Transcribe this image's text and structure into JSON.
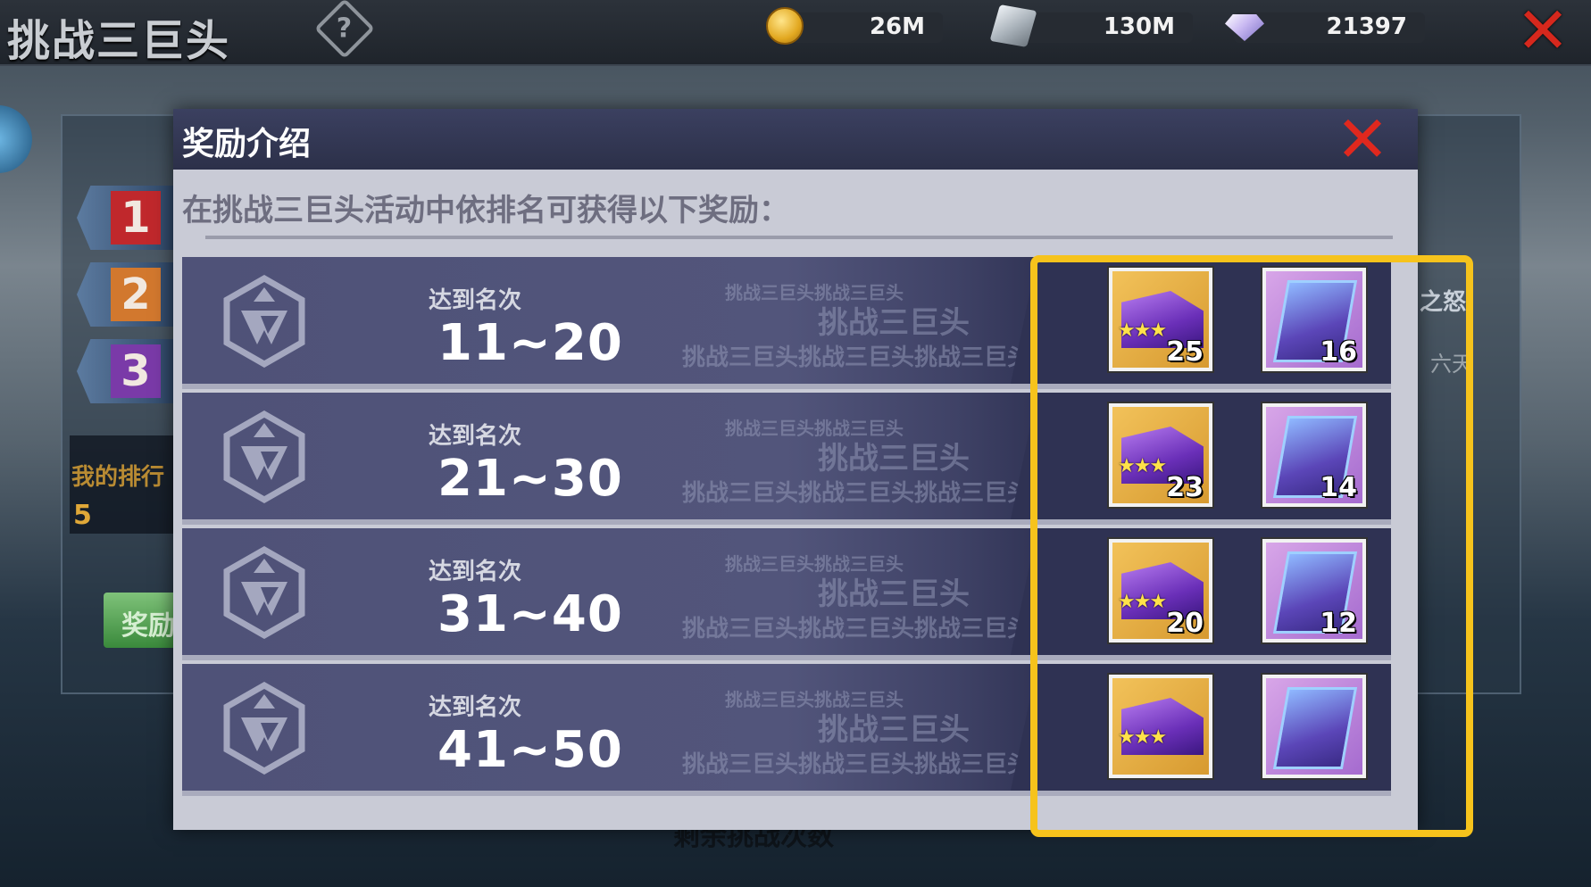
{
  "topbar": {
    "title": "挑战三巨头",
    "help_icon": "?",
    "resources": [
      {
        "name": "coin-icon",
        "value": "26M"
      },
      {
        "name": "cube-icon",
        "value": "130M"
      },
      {
        "name": "gem-icon",
        "value": "21397"
      }
    ],
    "close_glyph": "✕"
  },
  "background": {
    "rank_tabs": [
      "1",
      "2",
      "3"
    ],
    "rank_tab_colors": [
      "#c0282c",
      "#d2782e",
      "#7a3aa8"
    ],
    "my_rank_label": "我的排行",
    "my_rank_value": "5",
    "reward_button": "奖励",
    "right_text_1": "之怒",
    "right_text_2": "六天",
    "bottom_text": "剩余挑战次数"
  },
  "dialog": {
    "title": "奖励介绍",
    "close_glyph": "✕",
    "subtitle": "在挑战三巨头活动中依排名可获得以下奖励：",
    "watermark_small": "挑战三巨头挑战三巨头",
    "watermark_large": "挑战三巨头",
    "watermark_long": "挑战三巨头挑战三巨头挑战三巨头",
    "rows": [
      {
        "label": "达到名次",
        "range": "11~20",
        "rewards": [
          {
            "icon": "envelope-icon",
            "count": "25"
          },
          {
            "icon": "book-icon",
            "count": "16"
          }
        ]
      },
      {
        "label": "达到名次",
        "range": "21~30",
        "rewards": [
          {
            "icon": "envelope-icon",
            "count": "23"
          },
          {
            "icon": "book-icon",
            "count": "14"
          }
        ]
      },
      {
        "label": "达到名次",
        "range": "31~40",
        "rewards": [
          {
            "icon": "envelope-icon",
            "count": "20"
          },
          {
            "icon": "book-icon",
            "count": "12"
          }
        ]
      },
      {
        "label": "达到名次",
        "range": "41~50",
        "rewards": [
          {
            "icon": "envelope-icon",
            "count": ""
          },
          {
            "icon": "book-icon",
            "count": ""
          }
        ]
      }
    ]
  },
  "colors": {
    "highlight": "#f6c31c",
    "close_red": "#e0281e",
    "dialog_header": "#2c3049",
    "row_bg": "#4f5278"
  }
}
